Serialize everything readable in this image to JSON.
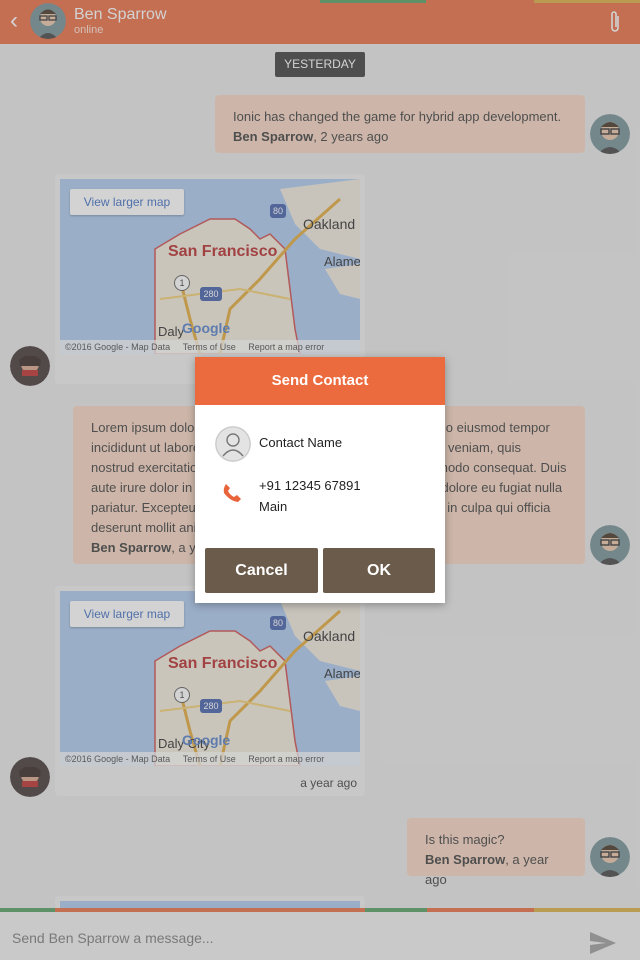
{
  "header": {
    "name": "Ben Sparrow",
    "status": "online",
    "back_icon": "chevron-left-icon",
    "attach_icon": "paperclip-icon",
    "color": "#e8643a"
  },
  "chat": {
    "date_chip": "YESTERDAY",
    "messages": [
      {
        "text": "Ionic has changed the game for hybrid app development.",
        "author": "Ben Sparrow",
        "time": ", 2 years ago"
      },
      {
        "map": {
          "view_larger": "View larger map",
          "city": "San Francisco",
          "oakland": "Oakland",
          "alameda": "Alame",
          "daly": "Daly",
          "google": "Google",
          "highway1": "1",
          "highway280": "280",
          "highway80": "80",
          "copyright": "©2016 Google - Map Data",
          "terms": "Terms of Use",
          "report": "Report a map error"
        }
      },
      {
        "text": "Lorem ipsum dolor sit amet, consectetur adipisicing elit, sed do eiusmod tempor incididunt ut labore et dolore magna aliqua. Ut enim ad minim veniam, quis nostrud exercitation ullamco laboris nisi ut aliquip ex ea commodo consequat. Duis aute irure dolor in reprehenderit in voluptate velit esse cillum dolore eu fugiat nulla pariatur. Excepteur sint occaecat cupidatat non proident, sunt in culpa qui officia deserunt mollit anim id est laborum.",
        "author": "Ben Sparrow",
        "time": ", a year ago"
      },
      {
        "map": {
          "view_larger": "View larger map",
          "city": "San Francisco",
          "oakland": "Oakland",
          "alameda": "Alame",
          "daly": "Daly City",
          "google": "Google",
          "highway1": "1",
          "highway280": "280",
          "highway80": "80",
          "copyright": "©2016 Google - Map Data",
          "terms": "Terms of Use",
          "report": "Report a map error"
        },
        "time": "a year ago"
      },
      {
        "text": "Is this magic?",
        "author": "Ben Sparrow",
        "time": ", a year ago"
      }
    ]
  },
  "input": {
    "placeholder": "Send Ben Sparrow a message...",
    "send_icon": "send-icon"
  },
  "modal": {
    "title": "Send Contact",
    "contact_name": "Contact Name",
    "phone": "+91 12345 67891",
    "phone_type": "Main",
    "cancel": "Cancel",
    "ok": "OK",
    "accent": "#ec6b3e",
    "button_color": "#6b5b4b"
  }
}
